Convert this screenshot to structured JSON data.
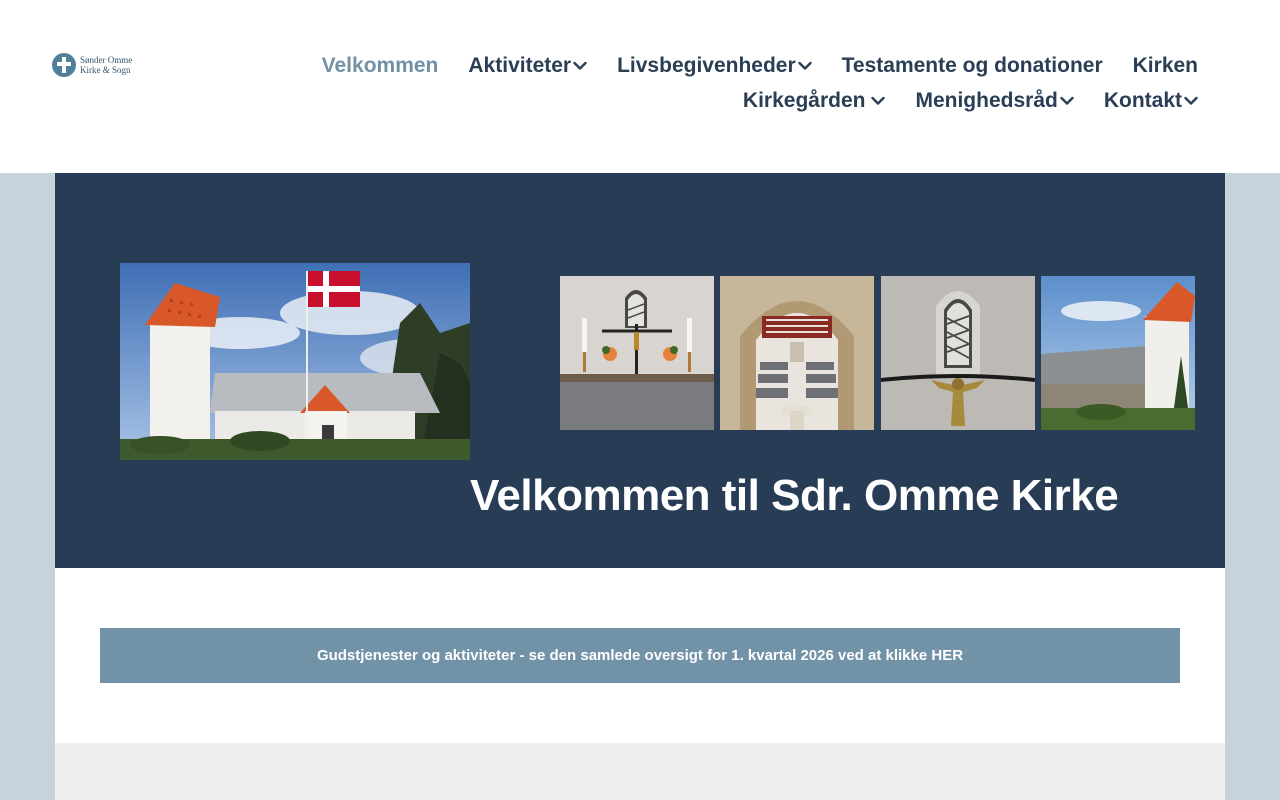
{
  "logo": {
    "line1": "Sønder Omme",
    "line2": "Kirke & Sogn"
  },
  "nav": {
    "row1": [
      {
        "label": "Velkommen",
        "has_dropdown": false,
        "active": true
      },
      {
        "label": "Aktiviteter",
        "has_dropdown": true
      },
      {
        "label": "Livsbegivenheder",
        "has_dropdown": true
      },
      {
        "label": "Testamente og donationer",
        "has_dropdown": false
      },
      {
        "label": "Kirken",
        "has_dropdown": false
      }
    ],
    "row2": [
      {
        "label": "Kirkegården",
        "has_dropdown": true
      },
      {
        "label": "Menighedsråd",
        "has_dropdown": true
      },
      {
        "label": "Kontakt",
        "has_dropdown": true
      }
    ]
  },
  "hero": {
    "title": "Velkommen til Sdr. Omme Kirke",
    "images": [
      "church-exterior-with-flag",
      "altar-with-crucifix",
      "church-interior-arch",
      "crucifix-under-window",
      "church-side-view"
    ]
  },
  "banner": {
    "text": "Gudstjenester og aktiviteter - se den samlede oversigt for 1. kvartal 2026 ved at klikke HER"
  },
  "colors": {
    "nav_text": "#2a3e55",
    "nav_active": "#7391a5",
    "hero_bg": "#283d55",
    "banner_bg": "#7292a7",
    "page_bg": "#c5d3dd"
  }
}
